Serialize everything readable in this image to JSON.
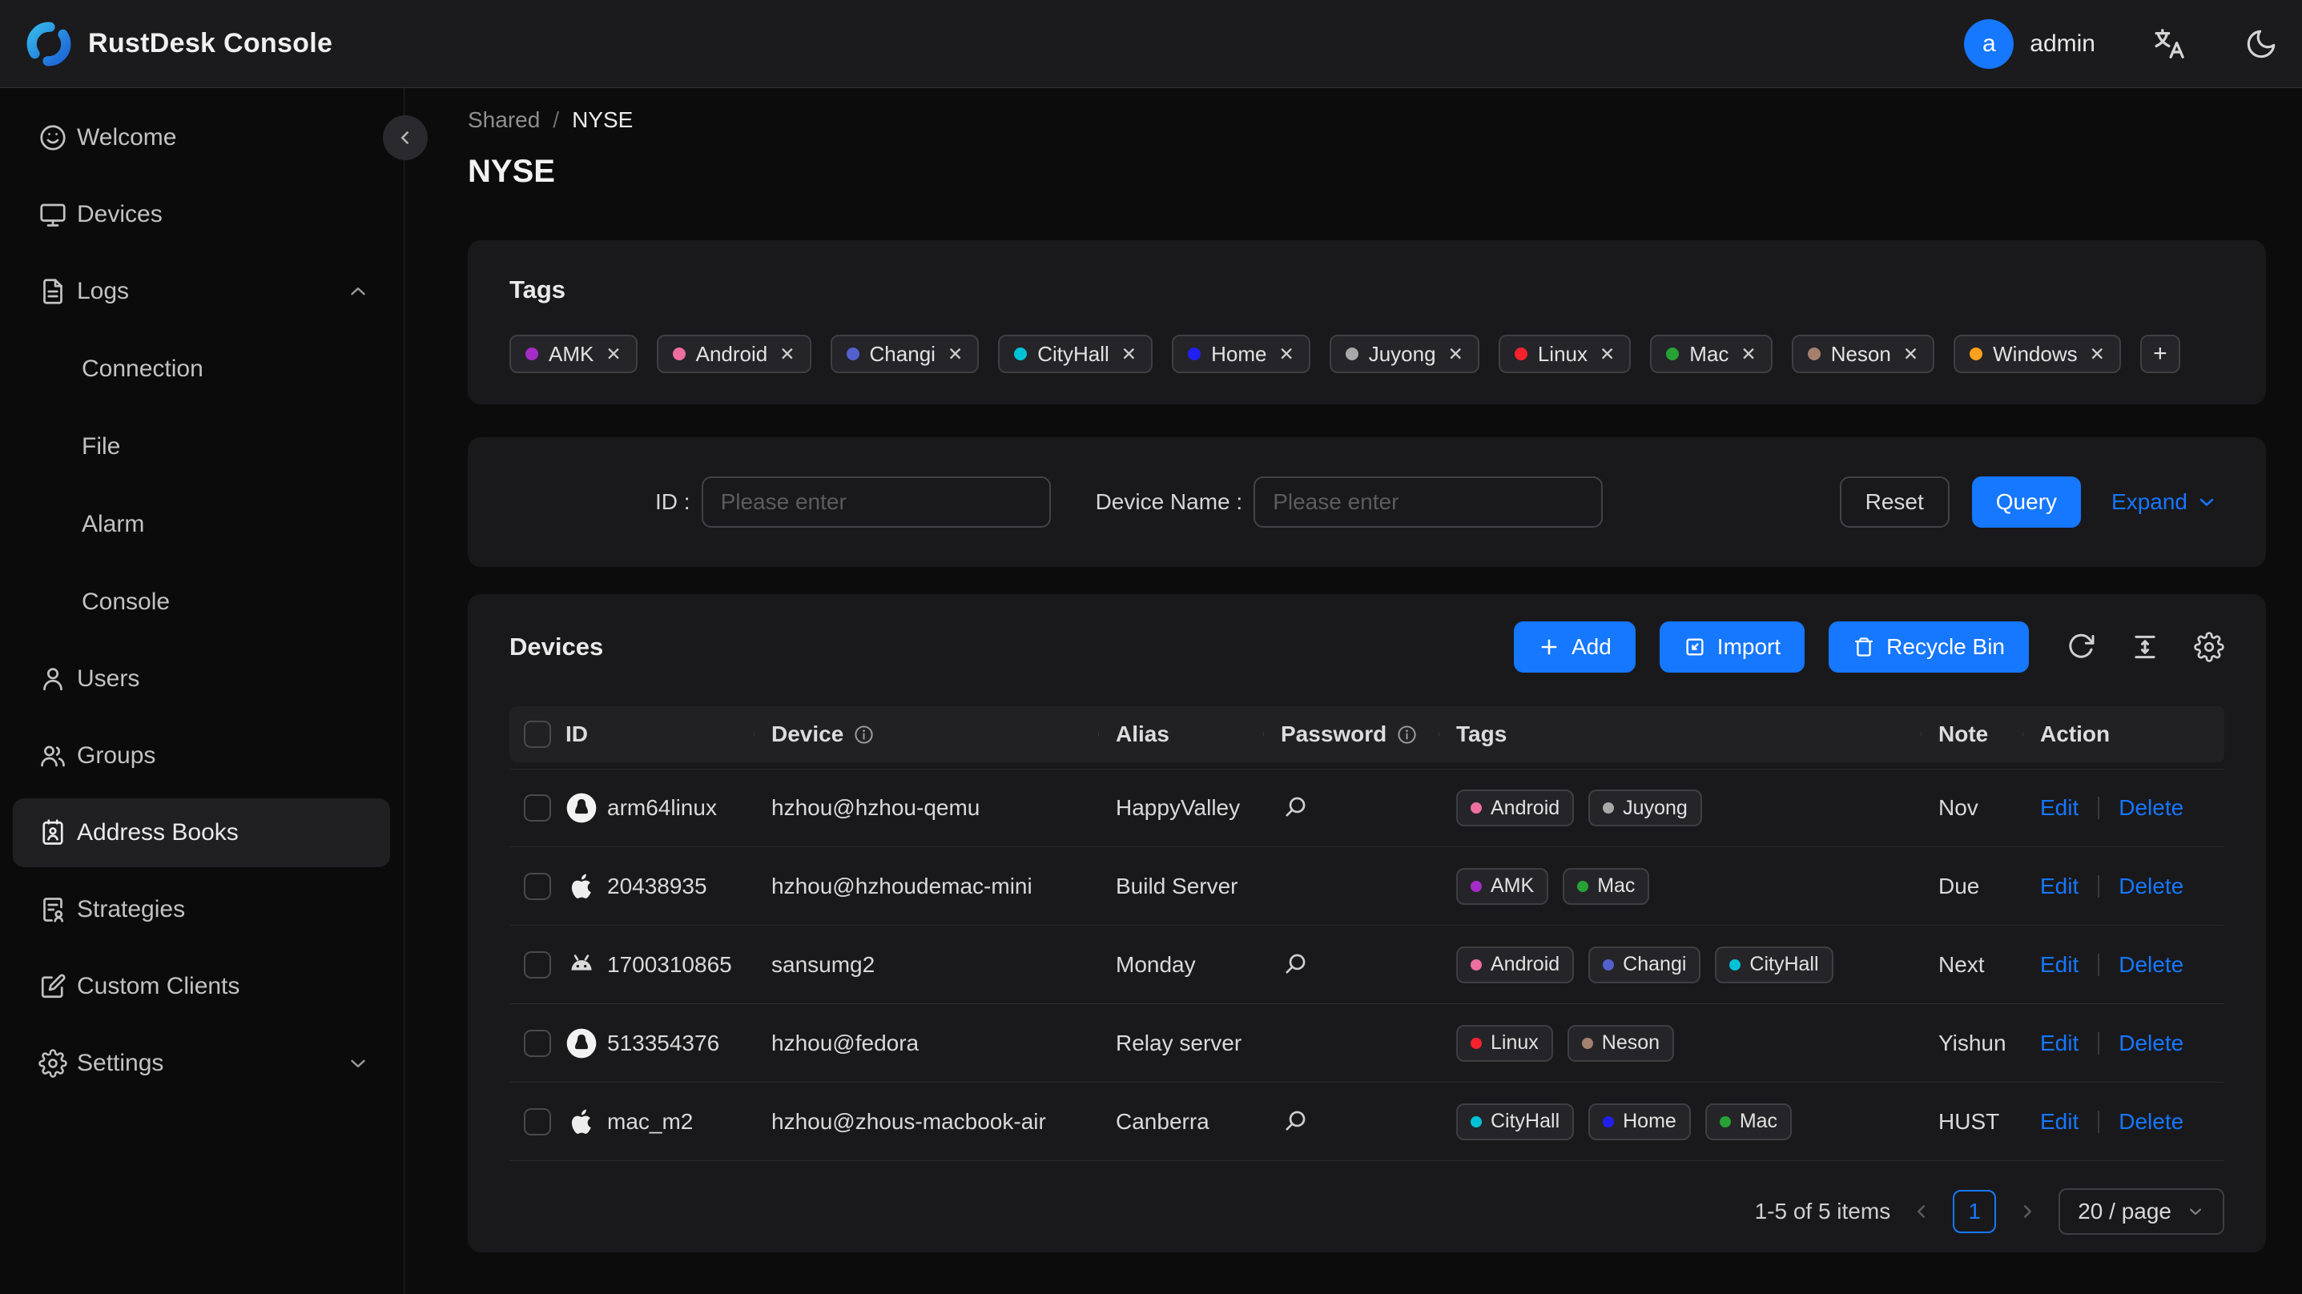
{
  "header": {
    "app_title": "RustDesk Console",
    "user_initial": "a",
    "user_name": "admin"
  },
  "sidebar": {
    "welcome": "Welcome",
    "devices": "Devices",
    "logs": "Logs",
    "connection": "Connection",
    "file": "File",
    "alarm": "Alarm",
    "console": "Console",
    "users": "Users",
    "groups": "Groups",
    "address_books": "Address Books",
    "strategies": "Strategies",
    "custom_clients": "Custom Clients",
    "settings": "Settings"
  },
  "breadcrumb": {
    "parent": "Shared",
    "separator": "/",
    "current": "NYSE"
  },
  "page_title": "NYSE",
  "tags_card": {
    "title": "Tags",
    "close_glyph": "✕",
    "add_label": "+",
    "tags": [
      {
        "label": "AMK",
        "color": "#a62cc8"
      },
      {
        "label": "Android",
        "color": "#ee6f9f"
      },
      {
        "label": "Changi",
        "color": "#5560cf"
      },
      {
        "label": "CityHall",
        "color": "#00c2d7"
      },
      {
        "label": "Home",
        "color": "#2020f0"
      },
      {
        "label": "Juyong",
        "color": "#a8a8a8"
      },
      {
        "label": "Linux",
        "color": "#f5222d"
      },
      {
        "label": "Mac",
        "color": "#27a336"
      },
      {
        "label": "Neson",
        "color": "#a5806f"
      },
      {
        "label": "Windows",
        "color": "#fba11d"
      }
    ]
  },
  "filter": {
    "id_label": "ID :",
    "id_placeholder": "Please enter",
    "device_name_label": "Device Name :",
    "device_name_placeholder": "Please enter",
    "reset_label": "Reset",
    "query_label": "Query",
    "expand_label": "Expand"
  },
  "devices_card": {
    "title": "Devices",
    "add_label": "Add",
    "import_label": "Import",
    "recycle_bin_label": "Recycle Bin",
    "table": {
      "columns": [
        {
          "label": "ID"
        },
        {
          "label": "Device",
          "info": true
        },
        {
          "label": "Alias"
        },
        {
          "label": "Password",
          "info": true
        },
        {
          "label": "Tags"
        },
        {
          "label": "Note"
        },
        {
          "label": "Action"
        }
      ],
      "edit_label": "Edit",
      "delete_label": "Delete",
      "rows": [
        {
          "os": "linux",
          "id": "arm64linux",
          "device": "hzhou@hzhou-qemu",
          "alias": "HappyValley",
          "has_password": true,
          "tags": [
            {
              "label": "Android",
              "color": "#ee6f9f"
            },
            {
              "label": "Juyong",
              "color": "#a8a8a8"
            }
          ],
          "note": "Nov"
        },
        {
          "os": "apple",
          "id": "20438935",
          "device": "hzhou@hzhoudemac-mini",
          "alias": "Build Server",
          "has_password": false,
          "tags": [
            {
              "label": "AMK",
              "color": "#a62cc8"
            },
            {
              "label": "Mac",
              "color": "#27a336"
            }
          ],
          "note": "Due"
        },
        {
          "os": "android",
          "id": "1700310865",
          "device": "sansumg2",
          "alias": "Monday",
          "has_password": true,
          "tags": [
            {
              "label": "Android",
              "color": "#ee6f9f"
            },
            {
              "label": "Changi",
              "color": "#5560cf"
            },
            {
              "label": "CityHall",
              "color": "#00c2d7"
            }
          ],
          "note": "Next"
        },
        {
          "os": "linux",
          "id": "513354376",
          "device": "hzhou@fedora",
          "alias": "Relay server",
          "has_password": false,
          "tags": [
            {
              "label": "Linux",
              "color": "#f5222d"
            },
            {
              "label": "Neson",
              "color": "#a5806f"
            }
          ],
          "note": "Yishun"
        },
        {
          "os": "apple",
          "id": "mac_m2",
          "device": "hzhou@zhous-macbook-air",
          "alias": "Canberra",
          "has_password": true,
          "tags": [
            {
              "label": "CityHall",
              "color": "#00c2d7"
            },
            {
              "label": "Home",
              "color": "#2020f0"
            },
            {
              "label": "Mac",
              "color": "#27a336"
            }
          ],
          "note": "HUST"
        }
      ]
    },
    "pagination": {
      "summary": "1-5 of 5 items",
      "page": "1",
      "page_size": "20 / page"
    }
  },
  "accent_color": "#1677ff"
}
